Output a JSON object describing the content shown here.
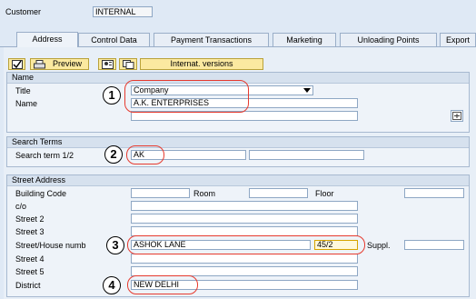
{
  "header": {
    "customer_label": "Customer",
    "customer_value": "INTERNAL"
  },
  "tabs": [
    {
      "label": "Address"
    },
    {
      "label": "Control Data"
    },
    {
      "label": "Payment Transactions"
    },
    {
      "label": "Marketing"
    },
    {
      "label": "Unloading Points"
    },
    {
      "label": "Export"
    }
  ],
  "toolbar": {
    "preview_label": "Preview",
    "intl_label": "Internat. versions"
  },
  "name_group": {
    "heading": "Name",
    "title_label": "Title",
    "title_value": "Company",
    "name_label": "Name",
    "name_value": "A.K. ENTERPRISES",
    "name2_value": ""
  },
  "search_group": {
    "heading": "Search Terms",
    "search_label": "Search term 1/2",
    "search1_value": "AK",
    "search2_value": ""
  },
  "street_group": {
    "heading": "Street Address",
    "building_label": "Building Code",
    "room_label": "Room",
    "floor_label": "Floor",
    "co_label": "c/o",
    "street2_label": "Street 2",
    "street3_label": "Street 3",
    "street_house_label": "Street/House numb",
    "street_value": "ASHOK LANE",
    "house_value": "45/2",
    "suppl_label": "Suppl.",
    "street4_label": "Street 4",
    "street5_label": "Street 5",
    "district_label": "District",
    "district_value": "NEW DELHI"
  },
  "markers": [
    "1",
    "2",
    "3",
    "4"
  ],
  "colors": {
    "highlight": "#e63a2e",
    "button": "#fbe9a0",
    "background": "#dfe9f5"
  }
}
